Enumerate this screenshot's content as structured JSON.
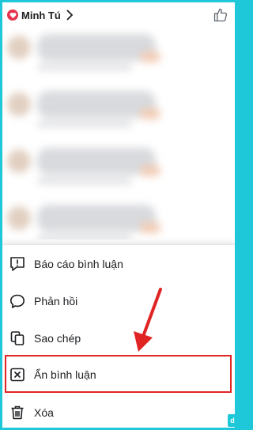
{
  "header": {
    "owner_name": "Minh Tú",
    "heart_icon": "heart-icon",
    "chevron_icon": "chevron-right-icon",
    "like_icon": "thumbs-up-icon"
  },
  "menu": {
    "items": [
      {
        "label": "Báo cáo bình luận",
        "icon": "report-icon"
      },
      {
        "label": "Phản hồi",
        "icon": "reply-icon"
      },
      {
        "label": "Sao chép",
        "icon": "copy-icon"
      },
      {
        "label": "Ẩn bình luận",
        "icon": "hide-icon"
      },
      {
        "label": "Xóa",
        "icon": "trash-icon"
      }
    ]
  },
  "colors": {
    "frame": "#1ec8d8",
    "highlight": "#e02424",
    "arrow": "#e02424",
    "heart": "#e5334f"
  }
}
